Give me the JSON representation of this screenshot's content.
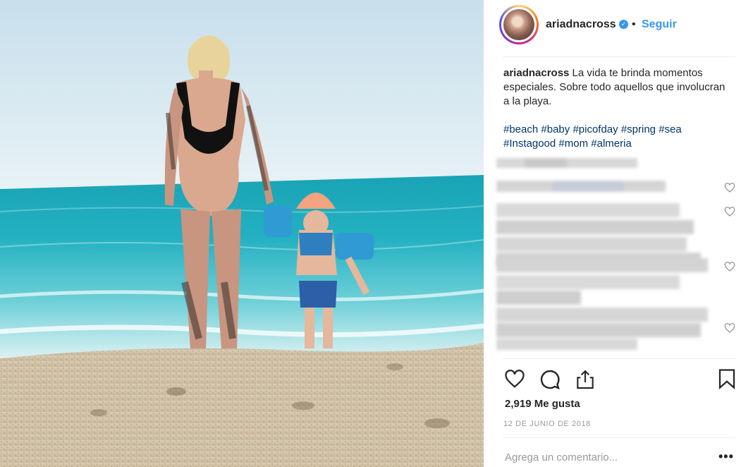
{
  "post": {
    "username": "ariadnacross",
    "follow_label": "Seguir",
    "dot": "•",
    "verified_badge": "✓",
    "caption_user": "ariadnacross",
    "caption_text": " La vida te brinda momentos especiales. Sobre todo aquellos que involucran a la playa.",
    "hashtags": [
      "#beach",
      "#baby",
      "#picofday",
      "#spring",
      "#sea",
      "#Instagood",
      "#mom",
      "#almeria"
    ],
    "likes": "2,919 Me gusta",
    "date": "12 DE JUNIO DE 2018",
    "comment_placeholder": "Agrega un comentario...",
    "more_label": "•••"
  },
  "icons": {
    "verified": "verified-check-icon",
    "like": "heart-icon",
    "comment": "speech-bubble-icon",
    "share": "share-arrow-icon",
    "save": "bookmark-icon",
    "comment_like": "heart-outline-icon"
  },
  "colors": {
    "accent": "#3897f0",
    "hashtag": "#003569",
    "muted": "#999999",
    "text": "#262626"
  }
}
